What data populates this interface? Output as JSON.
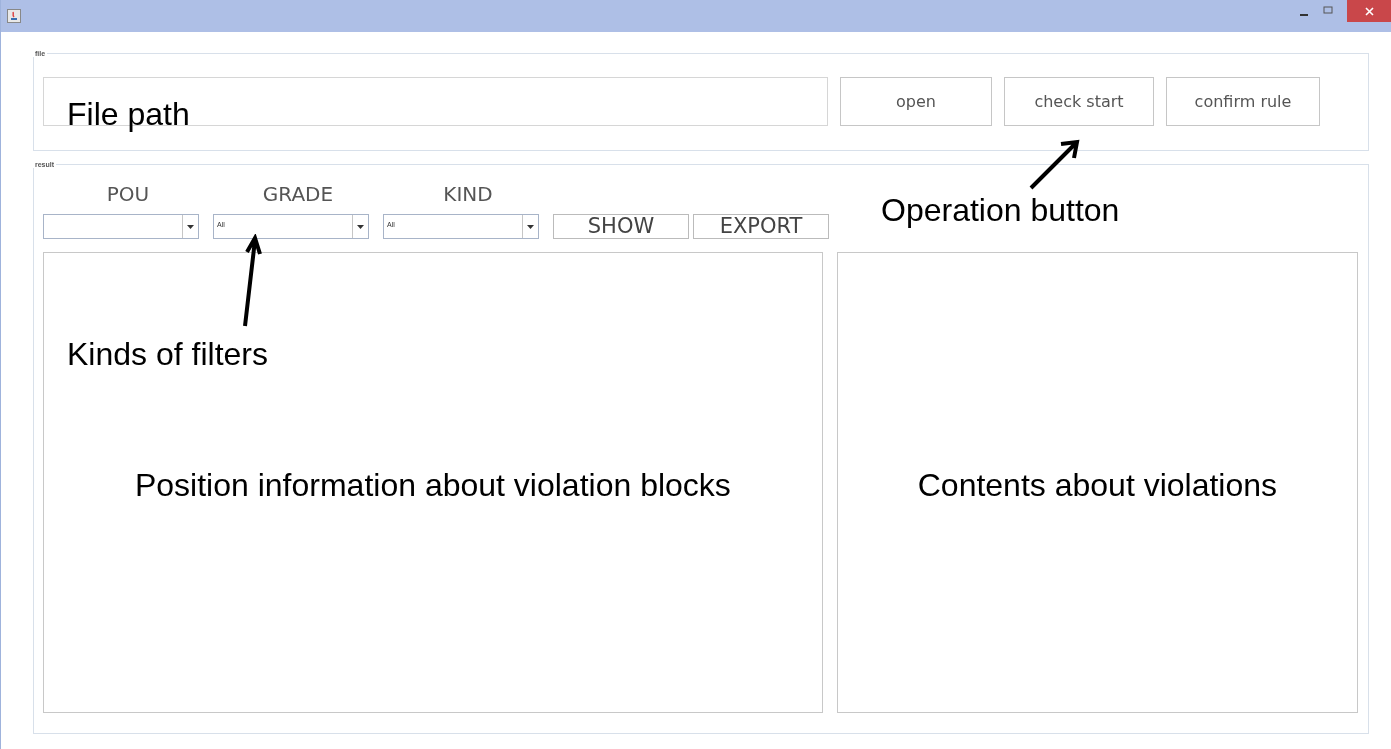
{
  "file_group": {
    "legend": "file",
    "buttons": [
      "open",
      "check start",
      "confirm rule"
    ]
  },
  "result_group": {
    "legend": "result",
    "filters": [
      {
        "label": "POU"
      },
      {
        "label": "GRADE",
        "value": "All"
      },
      {
        "label": "KIND",
        "value": "All"
      }
    ],
    "actions": [
      "SHOW",
      "EXPORT"
    ],
    "panels": [
      "Position information about violation blocks",
      "Contents about violations"
    ]
  },
  "annotations": [
    {
      "kind": "field",
      "text": "File path"
    },
    {
      "kind": "buttons",
      "text": "Operation button"
    },
    {
      "kind": "filters",
      "text": "Kinds of filters"
    }
  ]
}
